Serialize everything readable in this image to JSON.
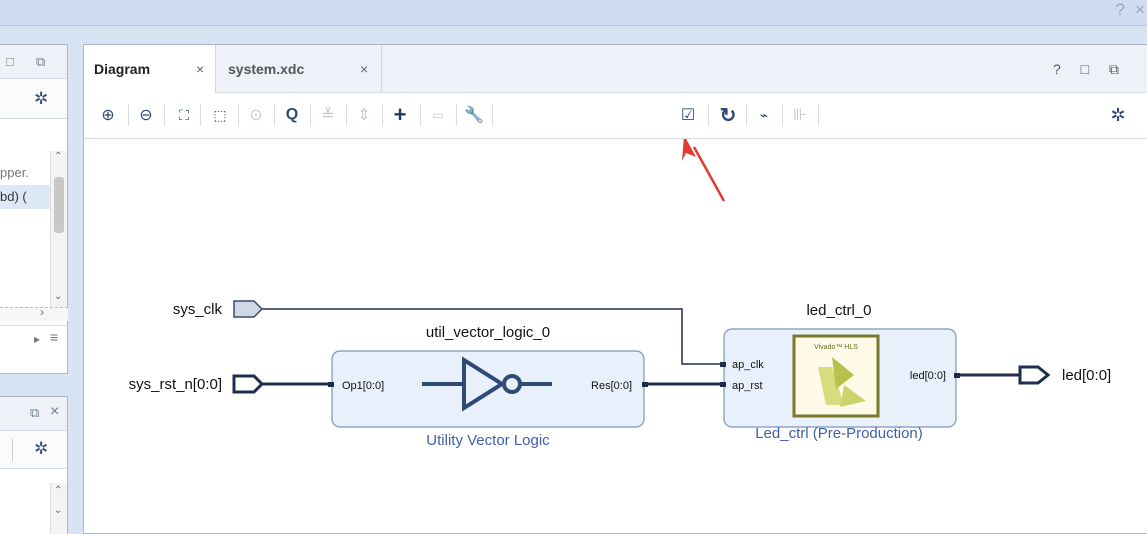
{
  "topbar": {
    "help": "?",
    "close": "×"
  },
  "left_panel_top": {
    "text_line1": "pper.",
    "text_line2": "bd) ("
  },
  "main": {
    "tabs": [
      {
        "label": "Diagram",
        "close": "×",
        "active": true
      },
      {
        "label": "system.xdc",
        "close": "×",
        "active": false
      }
    ],
    "tab_controls": "? □ ⧉"
  },
  "toolbar": {
    "icons": [
      "zoom-in-icon",
      "zoom-out-icon",
      "fit-icon",
      "fit-selection-icon",
      "center-icon",
      "search-icon",
      "collapse-icon",
      "expand-icon",
      "add-ip-icon",
      "pin-icon",
      "wrench-icon",
      "validate-icon",
      "refresh-icon",
      "route-icon",
      "port-icon",
      "gear-icon"
    ]
  },
  "diagram": {
    "ports_in": [
      {
        "name": "sys_clk"
      },
      {
        "name": "sys_rst_n[0:0]"
      }
    ],
    "port_out": {
      "name": "led[0:0]"
    },
    "block1": {
      "instance": "util_vector_logic_0",
      "pin_in": "Op1[0:0]",
      "pin_out": "Res[0:0]",
      "caption": "Utility Vector Logic"
    },
    "block2": {
      "instance": "led_ctrl_0",
      "pin_clk": "ap_clk",
      "pin_rst": "ap_rst",
      "pin_out": "led[0:0]",
      "logo_text": "Vivado™ HLS",
      "caption": "Led_ctrl (Pre-Production)"
    }
  },
  "colors": {
    "accent": "#2f4a76",
    "block_fill": "#e8f1fb",
    "block_border": "#7d95b8",
    "annotation": "#e53935",
    "caption": "#4060a8"
  }
}
